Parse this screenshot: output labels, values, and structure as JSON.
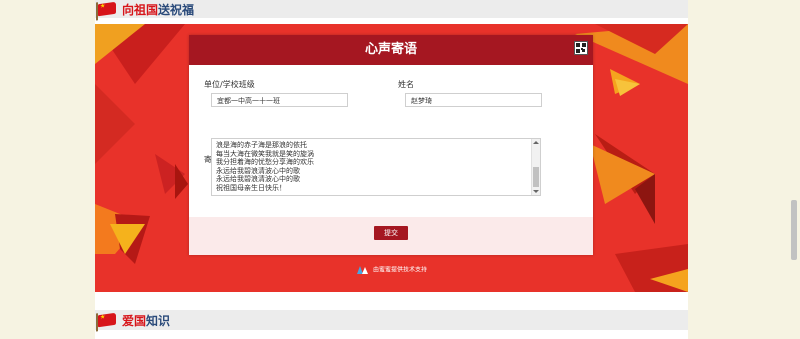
{
  "sections": {
    "top": {
      "title_red": "向祖国",
      "title_blue": "送祝福"
    },
    "bottom": {
      "title_red": "爱国",
      "title_blue": "知识"
    }
  },
  "form": {
    "title": "心声寄语",
    "unit_label": "单位/学校班级",
    "unit_value": "宜都一中高一十一班",
    "name_label": "姓名",
    "name_value": "赵梦琦",
    "message_label": "寄语",
    "message_lines": [
      "浪是海的赤子海是那浪的依托",
      "每当大海在微笑我就是笑的旋涡",
      "我分担着海的忧愁分享海的欢乐",
      "永远给我碧浪清波心中的歌",
      "永远给我碧浪清波心中的歌",
      "祝祖国母亲生日快乐！"
    ],
    "submit_label": "提交"
  },
  "footer": {
    "tech_support": "由蜜蜜提供技术支持"
  },
  "icons": {
    "flag": "china-flag-icon",
    "qr": "qr-code-icon",
    "logo": "provider-logo-icon"
  },
  "colors": {
    "header": "#a51721",
    "banner": "#e8322a",
    "accent_blue": "#2a4a7a"
  }
}
